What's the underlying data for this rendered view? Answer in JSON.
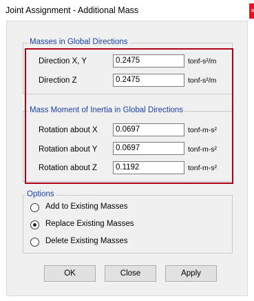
{
  "window": {
    "title": "Joint Assignment - Additional Mass",
    "close_glyph": "×"
  },
  "masses": {
    "legend": "Masses in Global Directions",
    "rows": [
      {
        "label": "Direction  X, Y",
        "value": "0.2475",
        "unit": "tonf-s²/m"
      },
      {
        "label": "Direction  Z",
        "value": "0.2475",
        "unit": "tonf-s²/m"
      }
    ]
  },
  "inertia": {
    "legend": "Mass Moment of Inertia in Global Directions",
    "rows": [
      {
        "label": "Rotation about  X",
        "value": "0.0697",
        "unit": "tonf-m-s²"
      },
      {
        "label": "Rotation about  Y",
        "value": "0.0697",
        "unit": "tonf-m-s²"
      },
      {
        "label": "Rotation about  Z",
        "value": "0.1192",
        "unit": "tonf-m-s²"
      }
    ]
  },
  "options": {
    "legend": "Options",
    "items": [
      {
        "label": "Add to Existing Masses",
        "checked": false
      },
      {
        "label": "Replace Existing Masses",
        "checked": true
      },
      {
        "label": "Delete Existing Masses",
        "checked": false
      }
    ]
  },
  "buttons": {
    "ok": "OK",
    "close": "Close",
    "apply": "Apply"
  },
  "colors": {
    "highlight": "#b00018",
    "legend": "#1a3fa8",
    "close_button": "#e81123"
  }
}
